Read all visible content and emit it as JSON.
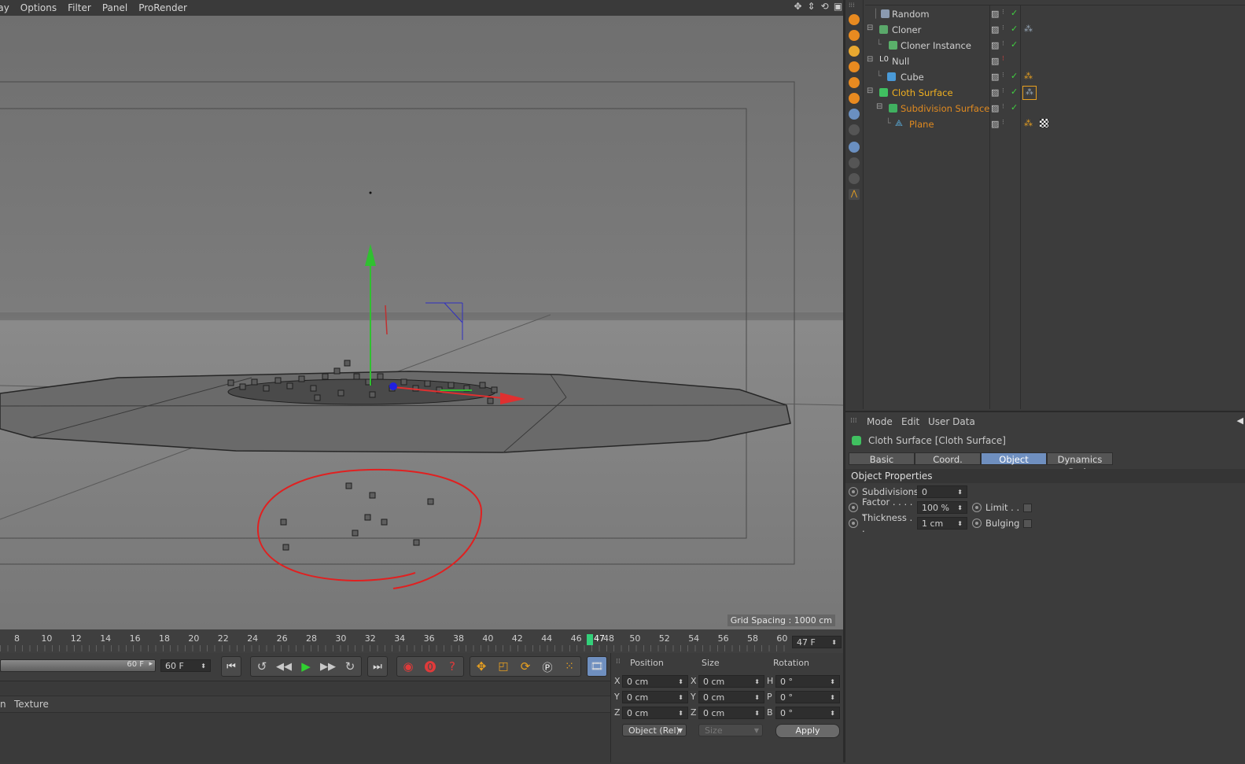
{
  "viewport_menu": [
    "lay",
    "Options",
    "Filter",
    "Panel",
    "ProRender"
  ],
  "viewport": {
    "grid_spacing": "Grid Spacing : 1000 cm"
  },
  "timeline": {
    "ticks": [
      "8",
      "10",
      "12",
      "14",
      "16",
      "18",
      "20",
      "22",
      "24",
      "26",
      "28",
      "30",
      "32",
      "34",
      "36",
      "38",
      "40",
      "42",
      "44",
      "46",
      "48",
      "50",
      "52",
      "54",
      "56",
      "58",
      "60"
    ],
    "current_frame": "47",
    "frame_field": "47 F"
  },
  "transport": {
    "end_frame_slider": "60 F",
    "end_frame_field": "60 F"
  },
  "material_bar": {
    "items": [
      "n",
      "Texture"
    ]
  },
  "coordinates": {
    "headers": {
      "position": "Position",
      "size": "Size",
      "rotation": "Rotation"
    },
    "rows": [
      {
        "axis": "X",
        "pos": "0 cm",
        "size_axis": "X",
        "size": "0 cm",
        "rot_axis": "H",
        "rot": "0 °"
      },
      {
        "axis": "Y",
        "pos": "0 cm",
        "size_axis": "Y",
        "size": "0 cm",
        "rot_axis": "P",
        "rot": "0 °"
      },
      {
        "axis": "Z",
        "pos": "0 cm",
        "size_axis": "Z",
        "size": "0 cm",
        "rot_axis": "B",
        "rot": "0 °"
      }
    ],
    "mode_dropdown": "Object (Rel)",
    "size_dropdown": "Size",
    "apply_label": "Apply"
  },
  "object_manager": {
    "objects": [
      {
        "name": "Random",
        "color": "#d0d0d0"
      },
      {
        "name": "Cloner",
        "color": "#d0d0d0"
      },
      {
        "name": "Cloner Instance",
        "color": "#d0d0d0"
      },
      {
        "name": "Null",
        "color": "#d0d0d0"
      },
      {
        "name": "Cube",
        "color": "#d0d0d0"
      },
      {
        "name": "Cloth Surface",
        "color": "#f0b020"
      },
      {
        "name": "Subdivision Surface",
        "color": "#e08a20"
      },
      {
        "name": "Plane",
        "color": "#e08a20"
      }
    ]
  },
  "attribute_manager": {
    "menu": [
      "Mode",
      "Edit",
      "User Data"
    ],
    "title": "Cloth Surface [Cloth Surface]",
    "tabs": [
      "Basic",
      "Coord.",
      "Object",
      "Dynamics Body"
    ],
    "active_tab": "Object",
    "section": "Object Properties",
    "props": {
      "subdivisions_label": "Subdivisions",
      "subdivisions_value": "0",
      "factor_label": "Factor . . . . .",
      "factor_value": "100 %",
      "limit_label": "Limit . .",
      "thickness_label": "Thickness . .",
      "thickness_value": "1 cm",
      "bulging_label": "Bulging"
    }
  }
}
